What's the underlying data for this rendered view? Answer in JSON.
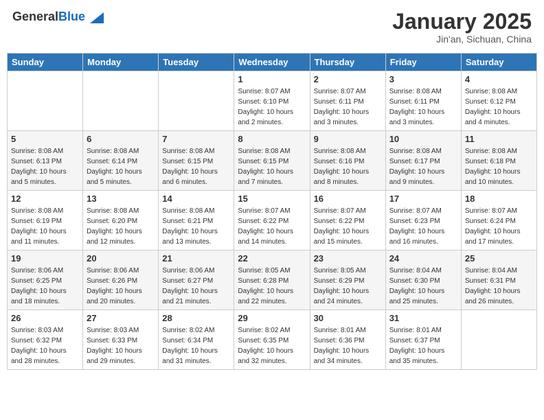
{
  "header": {
    "logo_general": "General",
    "logo_blue": "Blue",
    "month": "January 2025",
    "location": "Jin'an, Sichuan, China"
  },
  "weekdays": [
    "Sunday",
    "Monday",
    "Tuesday",
    "Wednesday",
    "Thursday",
    "Friday",
    "Saturday"
  ],
  "weeks": [
    [
      {
        "day": "",
        "info": ""
      },
      {
        "day": "",
        "info": ""
      },
      {
        "day": "",
        "info": ""
      },
      {
        "day": "1",
        "info": "Sunrise: 8:07 AM\nSunset: 6:10 PM\nDaylight: 10 hours\nand 2 minutes."
      },
      {
        "day": "2",
        "info": "Sunrise: 8:07 AM\nSunset: 6:11 PM\nDaylight: 10 hours\nand 3 minutes."
      },
      {
        "day": "3",
        "info": "Sunrise: 8:08 AM\nSunset: 6:11 PM\nDaylight: 10 hours\nand 3 minutes."
      },
      {
        "day": "4",
        "info": "Sunrise: 8:08 AM\nSunset: 6:12 PM\nDaylight: 10 hours\nand 4 minutes."
      }
    ],
    [
      {
        "day": "5",
        "info": "Sunrise: 8:08 AM\nSunset: 6:13 PM\nDaylight: 10 hours\nand 5 minutes."
      },
      {
        "day": "6",
        "info": "Sunrise: 8:08 AM\nSunset: 6:14 PM\nDaylight: 10 hours\nand 5 minutes."
      },
      {
        "day": "7",
        "info": "Sunrise: 8:08 AM\nSunset: 6:15 PM\nDaylight: 10 hours\nand 6 minutes."
      },
      {
        "day": "8",
        "info": "Sunrise: 8:08 AM\nSunset: 6:15 PM\nDaylight: 10 hours\nand 7 minutes."
      },
      {
        "day": "9",
        "info": "Sunrise: 8:08 AM\nSunset: 6:16 PM\nDaylight: 10 hours\nand 8 minutes."
      },
      {
        "day": "10",
        "info": "Sunrise: 8:08 AM\nSunset: 6:17 PM\nDaylight: 10 hours\nand 9 minutes."
      },
      {
        "day": "11",
        "info": "Sunrise: 8:08 AM\nSunset: 6:18 PM\nDaylight: 10 hours\nand 10 minutes."
      }
    ],
    [
      {
        "day": "12",
        "info": "Sunrise: 8:08 AM\nSunset: 6:19 PM\nDaylight: 10 hours\nand 11 minutes."
      },
      {
        "day": "13",
        "info": "Sunrise: 8:08 AM\nSunset: 6:20 PM\nDaylight: 10 hours\nand 12 minutes."
      },
      {
        "day": "14",
        "info": "Sunrise: 8:08 AM\nSunset: 6:21 PM\nDaylight: 10 hours\nand 13 minutes."
      },
      {
        "day": "15",
        "info": "Sunrise: 8:07 AM\nSunset: 6:22 PM\nDaylight: 10 hours\nand 14 minutes."
      },
      {
        "day": "16",
        "info": "Sunrise: 8:07 AM\nSunset: 6:22 PM\nDaylight: 10 hours\nand 15 minutes."
      },
      {
        "day": "17",
        "info": "Sunrise: 8:07 AM\nSunset: 6:23 PM\nDaylight: 10 hours\nand 16 minutes."
      },
      {
        "day": "18",
        "info": "Sunrise: 8:07 AM\nSunset: 6:24 PM\nDaylight: 10 hours\nand 17 minutes."
      }
    ],
    [
      {
        "day": "19",
        "info": "Sunrise: 8:06 AM\nSunset: 6:25 PM\nDaylight: 10 hours\nand 18 minutes."
      },
      {
        "day": "20",
        "info": "Sunrise: 8:06 AM\nSunset: 6:26 PM\nDaylight: 10 hours\nand 20 minutes."
      },
      {
        "day": "21",
        "info": "Sunrise: 8:06 AM\nSunset: 6:27 PM\nDaylight: 10 hours\nand 21 minutes."
      },
      {
        "day": "22",
        "info": "Sunrise: 8:05 AM\nSunset: 6:28 PM\nDaylight: 10 hours\nand 22 minutes."
      },
      {
        "day": "23",
        "info": "Sunrise: 8:05 AM\nSunset: 6:29 PM\nDaylight: 10 hours\nand 24 minutes."
      },
      {
        "day": "24",
        "info": "Sunrise: 8:04 AM\nSunset: 6:30 PM\nDaylight: 10 hours\nand 25 minutes."
      },
      {
        "day": "25",
        "info": "Sunrise: 8:04 AM\nSunset: 6:31 PM\nDaylight: 10 hours\nand 26 minutes."
      }
    ],
    [
      {
        "day": "26",
        "info": "Sunrise: 8:03 AM\nSunset: 6:32 PM\nDaylight: 10 hours\nand 28 minutes."
      },
      {
        "day": "27",
        "info": "Sunrise: 8:03 AM\nSunset: 6:33 PM\nDaylight: 10 hours\nand 29 minutes."
      },
      {
        "day": "28",
        "info": "Sunrise: 8:02 AM\nSunset: 6:34 PM\nDaylight: 10 hours\nand 31 minutes."
      },
      {
        "day": "29",
        "info": "Sunrise: 8:02 AM\nSunset: 6:35 PM\nDaylight: 10 hours\nand 32 minutes."
      },
      {
        "day": "30",
        "info": "Sunrise: 8:01 AM\nSunset: 6:36 PM\nDaylight: 10 hours\nand 34 minutes."
      },
      {
        "day": "31",
        "info": "Sunrise: 8:01 AM\nSunset: 6:37 PM\nDaylight: 10 hours\nand 35 minutes."
      },
      {
        "day": "",
        "info": ""
      }
    ]
  ]
}
